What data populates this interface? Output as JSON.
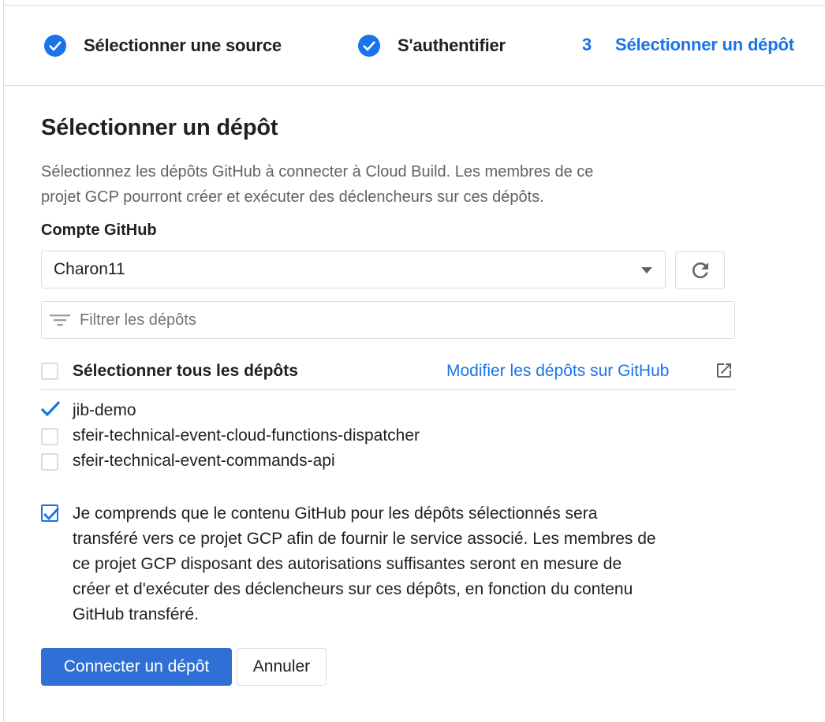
{
  "stepper": {
    "steps": [
      {
        "label": "Sélectionner une source",
        "status": "done"
      },
      {
        "label": "S'authentifier",
        "status": "done"
      },
      {
        "number": "3",
        "label": "Sélectionner un dépôt",
        "status": "active"
      }
    ]
  },
  "main": {
    "title": "Sélectionner un dépôt",
    "description_line1": "Sélectionnez les dépôts GitHub à connecter à Cloud Build. Les membres de ce",
    "description_line2": "projet GCP pourront créer et exécuter des déclencheurs sur ces dépôts.",
    "account_label": "Compte GitHub",
    "account_value": "Charon11",
    "filter_placeholder": "Filtrer les dépôts",
    "select_all_label": "Sélectionner tous les dépôts",
    "edit_link": "Modifier les dépôts sur GitHub",
    "repos": [
      {
        "name": "jib-demo",
        "checked": true
      },
      {
        "name": "sfeir-technical-event-cloud-functions-dispatcher",
        "checked": false
      },
      {
        "name": "sfeir-technical-event-commands-api",
        "checked": false
      }
    ],
    "consent": {
      "checked": true,
      "lines": [
        "Je comprends que le contenu GitHub pour les dépôts sélectionnés sera",
        "transféré vers ce projet GCP afin de fournir le service associé. Les membres de",
        "ce projet GCP disposant des autorisations suffisantes seront en mesure de",
        "créer et d'exécuter des déclencheurs sur ces dépôts, en fonction du contenu",
        "GitHub transféré."
      ]
    },
    "buttons": {
      "connect": "Connecter un dépôt",
      "cancel": "Annuler"
    }
  },
  "colors": {
    "accent": "#1a73e8",
    "primary_button": "#2f6fd6",
    "border": "#dadce0",
    "text": "#202124",
    "secondary_text": "#5f6368"
  },
  "icons": {
    "step_done": "check-circle-icon",
    "refresh": "refresh-icon",
    "filter": "filter-list-icon",
    "external": "open-in-new-icon",
    "dropdown": "chevron-down-icon"
  }
}
